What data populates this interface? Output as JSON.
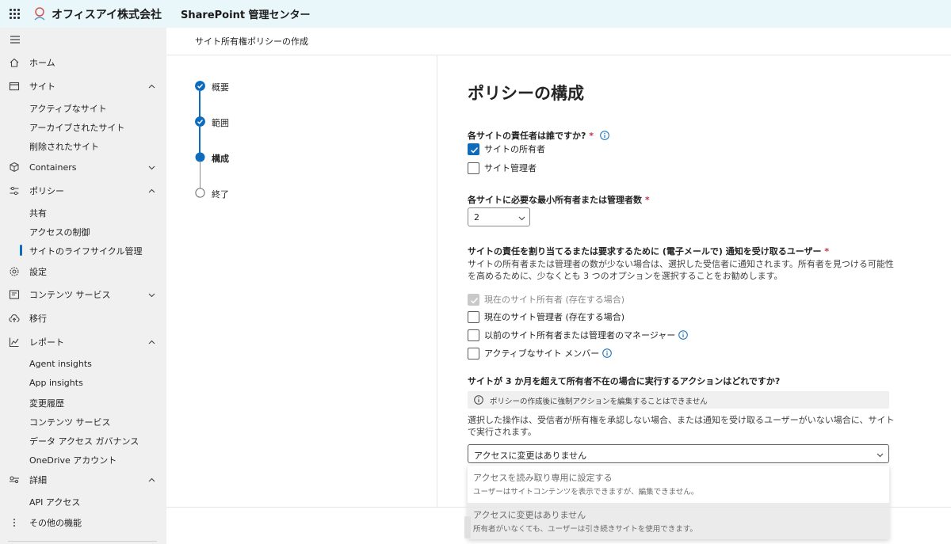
{
  "header": {
    "org_name": "オフィスアイ株式会社",
    "app_name": "SharePoint 管理センター"
  },
  "nav": {
    "home": "ホーム",
    "sites": "サイト",
    "sites_items": [
      "アクティブなサイト",
      "アーカイブされたサイト",
      "削除されたサイト"
    ],
    "containers": "Containers",
    "policies": "ポリシー",
    "policies_items": [
      "共有",
      "アクセスの制御",
      "サイトのライフサイクル管理"
    ],
    "settings": "設定",
    "content_services": "コンテンツ サービス",
    "migration": "移行",
    "reports": "レポート",
    "reports_items": [
      "Agent insights",
      "App insights",
      "変更履歴",
      "コンテンツ サービス",
      "データ アクセス ガバナンス",
      "OneDrive アカウント"
    ],
    "advanced": "詳細",
    "advanced_items": [
      "API アクセス"
    ],
    "more_features": "その他の機能"
  },
  "breadcrumb": "サイト所有権ポリシーの作成",
  "steps": [
    {
      "label": "概要",
      "state": "done"
    },
    {
      "label": "範囲",
      "state": "done"
    },
    {
      "label": "構成",
      "state": "current"
    },
    {
      "label": "終了",
      "state": "todo"
    }
  ],
  "main": {
    "title": "ポリシーの構成",
    "q1": {
      "label": "各サイトの責任者は誰ですか?",
      "required": "*",
      "options": [
        {
          "label": "サイトの所有者",
          "checked": true
        },
        {
          "label": "サイト管理者",
          "checked": false
        }
      ]
    },
    "q2": {
      "label": "各サイトに必要な最小所有者または管理者数",
      "required": "*",
      "value": "2"
    },
    "q3": {
      "label": "サイトの責任を割り当てるまたは要求するために (電子メールで) 通知を受け取るユーザー",
      "required": "*",
      "description": "サイトの所有者または管理者の数が少ない場合は、選択した受信者に通知されます。所有者を見つける可能性を高めるために、少なくとも 3 つのオプションを選択することをお勧めします。",
      "options": [
        {
          "label": "現在のサイト所有者 (存在する場合)",
          "checked": true,
          "disabled": true
        },
        {
          "label": "現在のサイト管理者 (存在する場合)",
          "checked": false,
          "disabled": false
        },
        {
          "label": "以前のサイト所有者または管理者のマネージャー",
          "checked": false,
          "disabled": false
        },
        {
          "label": "アクティブなサイト メンバー",
          "checked": false,
          "disabled": false
        }
      ]
    },
    "q4": {
      "label": "サイトが 3 か月を超えて所有者不在の場合に実行するアクションはどれですか?",
      "info_bar": "ポリシーの作成後に強制アクションを編集することはできません",
      "description": "選択した操作は、受信者が所有権を承認しない場合、または通知を受け取るユーザーがいない場合に、サイトで実行されます。",
      "selected": "アクセスに変更はありません",
      "options": [
        {
          "title": "アクセスを読み取り専用に設定する",
          "desc": "ユーザーはサイトコンテンツを表示できますが、編集できません。"
        },
        {
          "title": "アクセスに変更はありません",
          "desc": "所有者がいなくても、ユーザーは引き続きサイトを使用できます。"
        }
      ]
    }
  },
  "colors": {
    "accent": "#0f6cbd",
    "header_bg": "#e9f6fa",
    "nav_bg": "#f0f0f0",
    "required": "#c4314b"
  }
}
